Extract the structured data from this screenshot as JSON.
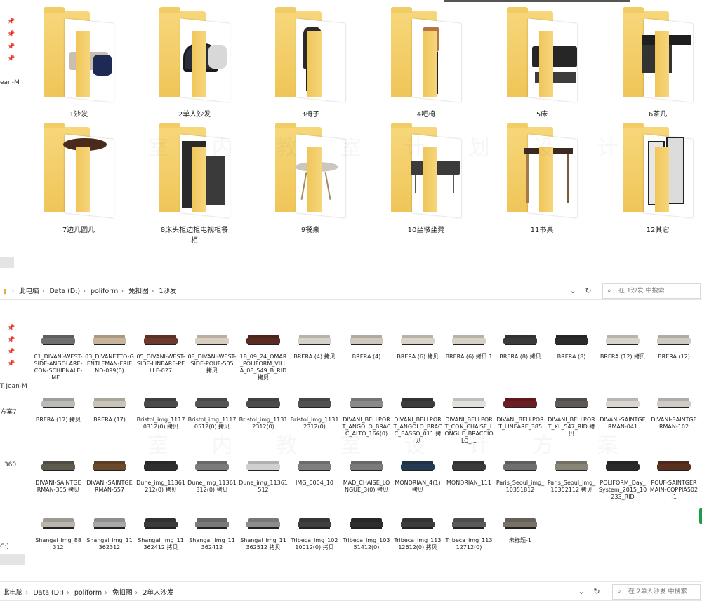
{
  "top_folders": [
    {
      "label": "1沙发",
      "col": 0,
      "row": 0,
      "furniture": "sofa"
    },
    {
      "label": "2单人沙发",
      "col": 1,
      "row": 0,
      "furniture": "armchair"
    },
    {
      "label": "3椅子",
      "col": 2,
      "row": 0,
      "furniture": "chair"
    },
    {
      "label": "4吧椅",
      "col": 3,
      "row": 0,
      "furniture": "barstool"
    },
    {
      "label": "5床",
      "col": 4,
      "row": 0,
      "furniture": "bed"
    },
    {
      "label": "6茶几",
      "col": 5,
      "row": 0,
      "furniture": "coffee-table"
    },
    {
      "label": "7边几圆几",
      "col": 0,
      "row": 1,
      "furniture": "round-table"
    },
    {
      "label": "8床头柜边柜电视柜餐柜",
      "col": 1,
      "row": 1,
      "furniture": "cabinet"
    },
    {
      "label": "9餐桌",
      "col": 2,
      "row": 1,
      "furniture": "dining-table"
    },
    {
      "label": "10坐墩坐凳",
      "col": 3,
      "row": 1,
      "furniture": "bench"
    },
    {
      "label": "11书桌",
      "col": 4,
      "row": 1,
      "furniture": "desk"
    },
    {
      "label": "12其它",
      "col": 5,
      "row": 1,
      "furniture": "mirror"
    }
  ],
  "left_stubs": [
    "ean-M",
    "T Jean-M",
    "方案7",
    ": 360",
    "C:)"
  ],
  "address_bar_1": {
    "crumbs": [
      "此电脑",
      "Data (D:)",
      "poliform",
      "免扣图",
      "1沙发"
    ],
    "search_placeholder": "在 1沙发 中搜索"
  },
  "address_bar_2": {
    "crumbs": [
      "此电脑",
      "Data (D:)",
      "poliform",
      "免扣图",
      "2单人沙发"
    ],
    "search_placeholder": "在 2单人沙发 中搜索"
  },
  "files": [
    [
      "01_DIVANI-WEST-SIDE-ANGOLARE-CON-SCHIENALE-ME...",
      "03_DIVANETTO-GENTLEMAN-FRIEND-099(0)",
      "05_DIVANI-WEST-SIDE-LINEARE-PELLE-027",
      "08_DIVANI-WEST-SIDE-POUF-505 拷贝",
      "18_09_24_OMAR_POLIFORM_VILLA_08_549_B_RID 拷贝",
      "BRERA (4) 拷贝",
      "BRERA (4)",
      "BRERA (6) 拷贝",
      "BRERA (6) 拷贝 1",
      "BRERA (8) 拷贝",
      "BRERA (8)",
      "BRERA (12) 拷贝",
      "BRERA (12)"
    ],
    [
      "BRERA (17) 拷贝",
      "BRERA (17)",
      "Bristol_img_11170312(0) 拷贝",
      "Bristol_img_11170512(0) 拷贝",
      "Bristol_img_11312312(0)",
      "Bristol_img_11312312(0)",
      "DIVANI_BELLPORT_ANGOLO_BRACC_ALTO_166(0)",
      "DIVANI_BELLPORT_ANGOLO_BRACC_BASSO_011 拷贝",
      "DIVANI_BELLPORT_CON_CHAISE_LONGUE_BRACCIOLO_...",
      "DIVANI_BELLPORT_LINEARE_385",
      "DIVANI_BELLPORT_XL_547_RID 拷贝",
      "DIVANI-SAINTGERMAN-041",
      "DIVANI-SAINTGERMAN-102"
    ],
    [
      "DIVANI-SAINTGERMAN-355 拷贝",
      "DIVANI-SAINTGERMAN-557",
      "Dune_img_11361212(0) 拷贝",
      "Dune_img_11361312(0) 拷贝",
      "Dune_img_11361512",
      "IMG_0004_10",
      "MAD_CHAISE_LONGUE_3(0) 拷贝",
      "MONDRIAN_4(1) 拷贝",
      "MONDRIAN_111",
      "Paris_Seoul_img_10351812",
      "Paris_Seoul_img_10352112 拷贝",
      "POLIFORM_Day_System_2015_10233_RID",
      "POUF-SAINTGERMAIN-COPPIA502-1"
    ],
    [
      "Shangai_img_88312",
      "Shangai_img_11362312",
      "Shangai_img_11362412 拷贝",
      "Shangai_img_11362412",
      "Shangai_img_11362512 拷贝",
      "Tribeca_img_10210012(0) 拷贝",
      "Tribeca_img_10351412(0)",
      "Tribeca_img_11312612(0) 拷贝",
      "Tribeca_img_11312712(0)",
      "未标题-1"
    ]
  ],
  "sofa_colors": [
    "#6f6f6f",
    "#c7b49a",
    "#6b3a2c",
    "#d8cfc0",
    "#5b2a22",
    "#d6d2cb",
    "#cfc8bc",
    "#d9d3c8",
    "#d8d2c6",
    "#3a3a3a",
    "#2b2b2b",
    "#d8d4cc",
    "#cfcac2",
    "#bcbab6",
    "#c9c3b8",
    "#4a4a4a",
    "#555555",
    "#4c4c4c",
    "#525252",
    "#8a8a8a",
    "#3c3c3c",
    "#e3e1dd",
    "#6d1e22",
    "#5e5a55",
    "#d9d6d0",
    "#cfccc6",
    "#5f5a4e",
    "#6a4a2a",
    "#2f2f2f",
    "#7b7b7b",
    "#d0d0d0",
    "#7e7e7e",
    "#7a7a7a",
    "#243b52",
    "#3a3a3a",
    "#6f6f6f",
    "#8a8476",
    "#2a2a2a",
    "#5a3020",
    "#b9b5ad",
    "#a8a8a8",
    "#3a3a3a",
    "#7a7a7a",
    "#8d8d8d",
    "#3f3f3f",
    "#2e2e2e",
    "#3c3c3c",
    "#5a5a5a",
    "#777167",
    "#c8c6c2"
  ]
}
